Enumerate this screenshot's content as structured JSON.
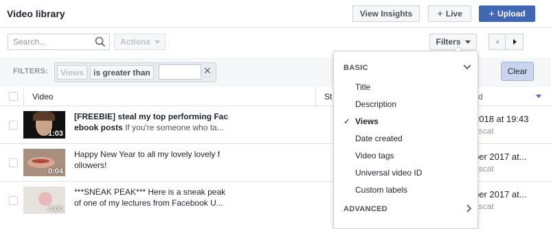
{
  "header": {
    "title": "Video library",
    "view_insights": "View Insights",
    "live": "Live",
    "upload": "Upload"
  },
  "toolbar": {
    "search_placeholder": "Search...",
    "actions": "Actions",
    "filters": "Filters"
  },
  "filter_bar": {
    "label": "FILTERS:",
    "field": "Views",
    "operator": "is greater than",
    "value": "",
    "clear": "Clear"
  },
  "table": {
    "columns": {
      "video": "Video",
      "status_partial": "St",
      "date_partial": "d"
    },
    "rows": [
      {
        "title": "[FREEBIE] steal my top performing Fac",
        "title2": "ebook posts",
        "desc": " If you're someone who ta...",
        "duration": "1:03",
        "date": "2018 at 19:43",
        "author": "ascat"
      },
      {
        "title": "",
        "title2": "",
        "desc": "Happy New Year to all my lovely lovely f",
        "desc2": "ollowers!",
        "duration": "0:04",
        "date": "ber 2017 at...",
        "author": "ascat"
      },
      {
        "title": "",
        "title2": "",
        "desc": "***SNEAK PEAK*** Here is a sneak peak",
        "desc2": "of one of my lectures from Facebook U...",
        "duration": "4:00",
        "date": "ber 2017 at...",
        "author": "ascat"
      }
    ]
  },
  "dropdown": {
    "basic": "BASIC",
    "items": [
      "Title",
      "Description",
      "Views",
      "Date created",
      "Video tags",
      "Universal video ID",
      "Custom labels"
    ],
    "selected": "Views",
    "advanced": "ADVANCED"
  }
}
